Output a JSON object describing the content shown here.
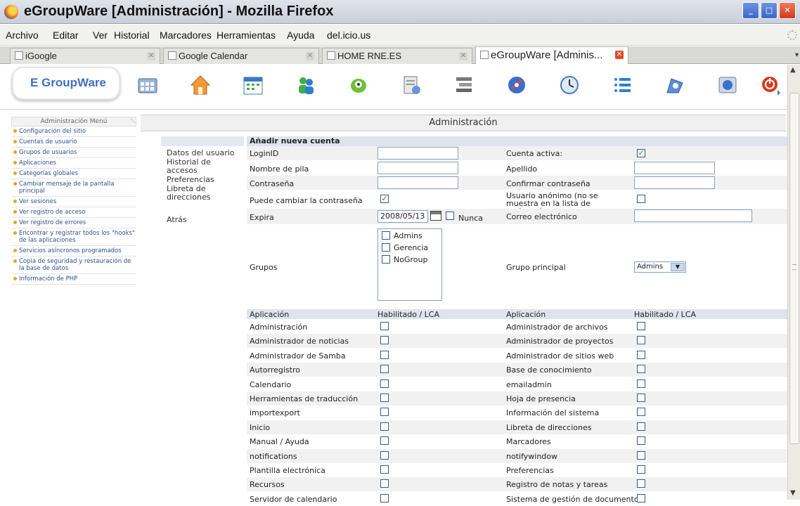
{
  "window": {
    "title": "eGroupWare [Administración] - Mozilla Firefox"
  },
  "menubar": [
    "Archivo",
    "Editar",
    "Ver",
    "Historial",
    "Marcadores",
    "Herramientas",
    "Ayuda",
    "del.icio.us"
  ],
  "tabs": [
    {
      "label": "iGoogle",
      "active": false
    },
    {
      "label": "Google Calendar",
      "active": false
    },
    {
      "label": "HOME RNE.ES",
      "active": false
    },
    {
      "label": "eGroupWare [Adminis...",
      "active": true
    }
  ],
  "logo": "E GroupWare",
  "app_icons": [
    "admin-icon",
    "home-icon",
    "calendar-icon",
    "addressbook-icon",
    "infolog-icon",
    "projects-icon",
    "filemanager-icon",
    "bookmarks-icon",
    "timesheet-icon",
    "wiki-icon",
    "knowledge-icon",
    "browser-icon",
    "logout-icon"
  ],
  "leftmenu": {
    "title": "Administración Menú",
    "items": [
      "Configuración del sitio",
      "Cuentas de usuario",
      "Grupos de usuarios",
      "Aplicaciones",
      "Categorías globales",
      "Cambiar mensaje de la pantalla principal",
      "Ver sesiones",
      "Ver registro de acceso",
      "Ver registro de errores",
      "Encontrar y registrar todos los \"hooks\" de las aplicaciones",
      "Servicios asíncronos programados",
      "Copia de seguridad y restauración de la base de datos",
      "Información de PHP"
    ]
  },
  "content_title": "Administración",
  "subnav": [
    "Datos del usuario",
    "Historial de accesos",
    "Preferencias",
    "Libreta de direcciones",
    "Atrás"
  ],
  "form": {
    "heading": "Añadir nueva cuenta",
    "loginid_label": "LoginID",
    "active_label": "Cuenta activa:",
    "firstname_label": "Nombre de pila",
    "lastname_label": "Apellido",
    "password_label": "Contraseña",
    "password_confirm_label": "Confirmar contraseña",
    "can_change_pw_label": "Puede cambiar la contraseña",
    "anonymous_label": "Usuario anónimo (no se muestra en la lista de sesiones)",
    "expires_label": "Expira",
    "expires_value": "2008/05/13",
    "never_label": "Nunca",
    "email_label": "Correo electrónico",
    "groups_label": "Grupos",
    "groups": [
      "Admins",
      "Gerencia",
      "NoGroup"
    ],
    "primary_group_label": "Grupo principal",
    "primary_group_value": "Admins",
    "active_checked": true,
    "can_change_pw_checked": true
  },
  "apps_table": {
    "col_app": "Aplicación",
    "col_enabled": "Habilitado / LCA",
    "left": [
      "Administración",
      "Administrador de noticias",
      "Administrador de Samba",
      "Autorregistro",
      "Calendario",
      "Herramientas de traducción",
      "importexport",
      "Inicio",
      "Manual / Ayuda",
      "notifications",
      "Plantilla electrónica",
      "Recursos",
      "Servidor de calendario"
    ],
    "right": [
      "Administrador de archivos",
      "Administrador de proyectos",
      "Administrador de sitios web",
      "Base de conocimiento",
      "emailadmin",
      "Hoja de presencia",
      "Información del sistema",
      "Libreta de direcciones",
      "Marcadores",
      "notifywindow",
      "Preferencias",
      "Registro de notas y tareas",
      "Sistema de gestión de documentos"
    ]
  }
}
